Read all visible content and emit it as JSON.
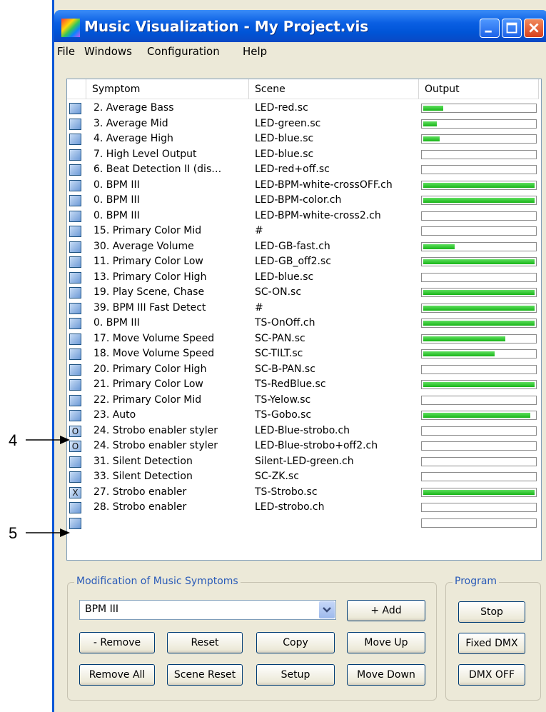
{
  "window": {
    "title": "Music Visualization - My Project.vis"
  },
  "menu": [
    "File",
    "Windows",
    "Configuration",
    "Help"
  ],
  "columns": {
    "symptom": "Symptom",
    "scene": "Scene",
    "output": "Output"
  },
  "rows": [
    {
      "check": "",
      "symptom": "2. Average Bass",
      "scene": "LED-red.sc",
      "level": 0.18
    },
    {
      "check": "",
      "symptom": "3. Average Mid",
      "scene": "LED-green.sc",
      "level": 0.12
    },
    {
      "check": "",
      "symptom": "4. Average High",
      "scene": "LED-blue.sc",
      "level": 0.15
    },
    {
      "check": "",
      "symptom": "7. High Level Output",
      "scene": "LED-blue.sc",
      "level": 0
    },
    {
      "check": "",
      "symptom": "6. Beat Detection II (dis…",
      "scene": "LED-red+off.sc",
      "level": 0
    },
    {
      "check": "",
      "symptom": "0. BPM III",
      "scene": "LED-BPM-white-crossOFF.ch",
      "level": 1
    },
    {
      "check": "",
      "symptom": "0. BPM III",
      "scene": "LED-BPM-color.ch",
      "level": 1
    },
    {
      "check": "",
      "symptom": "0. BPM III",
      "scene": "LED-BPM-white-cross2.ch",
      "level": 0
    },
    {
      "check": "",
      "symptom": "15. Primary Color Mid",
      "scene": "#",
      "level": 0
    },
    {
      "check": "",
      "symptom": "30. Average Volume",
      "scene": "LED-GB-fast.ch",
      "level": 0.28
    },
    {
      "check": "",
      "symptom": "11. Primary Color Low",
      "scene": "LED-GB_off2.sc",
      "level": 1
    },
    {
      "check": "",
      "symptom": "13. Primary Color High",
      "scene": "LED-blue.sc",
      "level": 0
    },
    {
      "check": "",
      "symptom": "19. Play Scene, Chase",
      "scene": "SC-ON.sc",
      "level": 1
    },
    {
      "check": "",
      "symptom": "39. BPM III Fast Detect",
      "scene": "#",
      "level": 1
    },
    {
      "check": "",
      "symptom": "0. BPM III",
      "scene": "TS-OnOff.ch",
      "level": 1
    },
    {
      "check": "",
      "symptom": "17. Move Volume Speed",
      "scene": "SC-PAN.sc",
      "level": 0.74
    },
    {
      "check": "",
      "symptom": "18. Move Volume Speed",
      "scene": "SC-TILT.sc",
      "level": 0.64
    },
    {
      "check": "",
      "symptom": "20. Primary Color High",
      "scene": "SC-B-PAN.sc",
      "level": 0
    },
    {
      "check": "",
      "symptom": "21. Primary Color Low",
      "scene": "TS-RedBlue.sc",
      "level": 1
    },
    {
      "check": "",
      "symptom": "22. Primary Color Mid",
      "scene": "TS-Yelow.sc",
      "level": 0
    },
    {
      "check": "",
      "symptom": "23. Auto",
      "scene": "TS-Gobo.sc",
      "level": 0.96
    },
    {
      "check": "O",
      "symptom": "24. Strobo enabler styler",
      "scene": "LED-Blue-strobo.ch",
      "level": 0
    },
    {
      "check": "O",
      "symptom": "24. Strobo enabler styler",
      "scene": "LED-Blue-strobo+off2.ch",
      "level": 0
    },
    {
      "check": "",
      "symptom": "31. Silent Detection",
      "scene": "Silent-LED-green.ch",
      "level": 0
    },
    {
      "check": "",
      "symptom": "33. Silent Detection",
      "scene": "SC-ZK.sc",
      "level": 0
    },
    {
      "check": "X",
      "symptom": "27. Strobo enabler",
      "scene": "TS-Strobo.sc",
      "level": 1
    },
    {
      "check": "",
      "symptom": "28. Strobo enabler",
      "scene": "LED-strobo.ch",
      "level": 0
    },
    {
      "check": "",
      "symptom": "",
      "scene": "",
      "level": 0
    }
  ],
  "modification": {
    "label": "Modification of Music Symptoms",
    "selected": "BPM III",
    "add": "+ Add",
    "remove": "- Remove",
    "reset": "Reset",
    "copy": "Copy",
    "move_up": "Move Up",
    "remove_all": "Remove All",
    "scene_reset": "Scene Reset",
    "setup": "Setup",
    "move_down": "Move Down"
  },
  "program": {
    "label": "Program",
    "stop": "Stop",
    "fixed_dmx": "Fixed DMX",
    "dmx_off": "DMX OFF"
  },
  "annotations": [
    "4",
    "5"
  ],
  "colors": {
    "title_bar": "#0a5fe3",
    "level_fill": "#18b418",
    "dialog_bg": "#ece9d8"
  }
}
